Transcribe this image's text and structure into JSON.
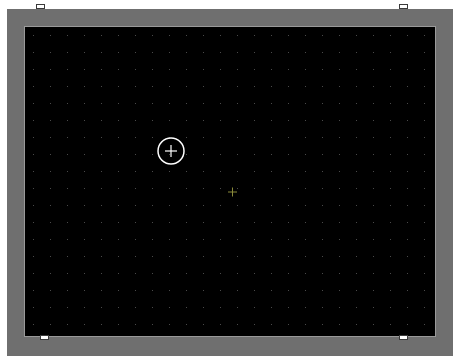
{
  "workspace": {
    "frame_color": "#6f6f6f",
    "canvas_color": "#000000",
    "grid_dot_color": "#4a4a4a",
    "cursor_color": "#ffffff",
    "target_color": "#8a8a3a"
  },
  "icons": {
    "cursor": "crosshair-circle-icon",
    "target": "small-crosshair-icon",
    "handle": "resize-handle-icon"
  }
}
